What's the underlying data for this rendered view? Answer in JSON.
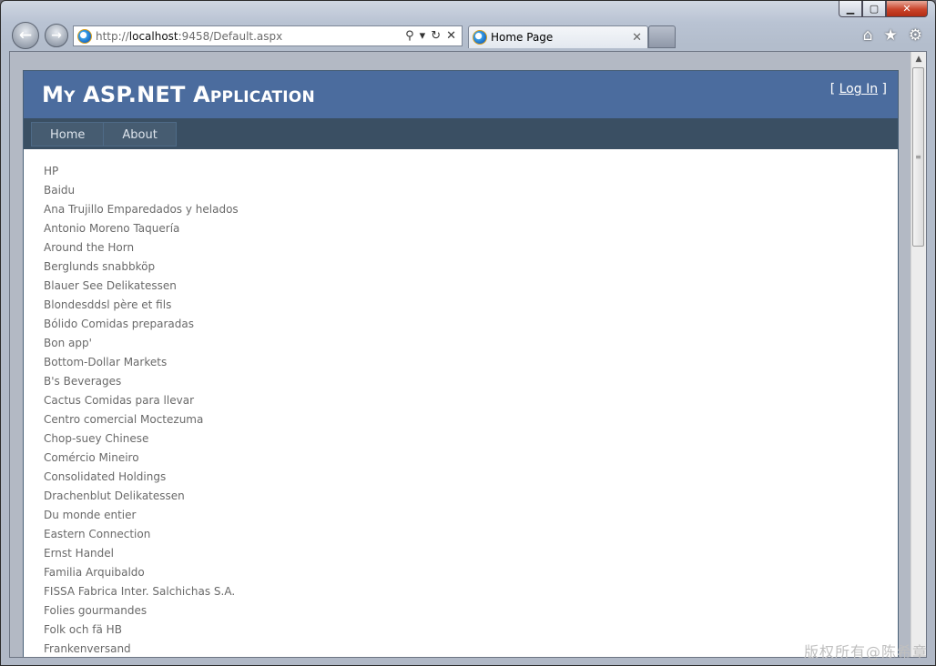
{
  "browser": {
    "address_prefix": "http://",
    "address_host": "localhost",
    "address_rest": ":9458/Default.aspx",
    "tab_title": "Home Page"
  },
  "app": {
    "title": "My ASP.NET Application",
    "login_open": "[ ",
    "login_link": "Log In",
    "login_close": " ]"
  },
  "menu": {
    "items": [
      {
        "label": "Home"
      },
      {
        "label": "About"
      }
    ]
  },
  "customers": [
    "HP",
    "Baidu",
    "Ana Trujillo Emparedados y helados",
    "Antonio Moreno Taquería",
    "Around the Horn",
    "Berglunds snabbköp",
    "Blauer See Delikatessen",
    "Blondesddsl père et fils",
    "Bólido Comidas preparadas",
    "Bon app'",
    "Bottom-Dollar Markets",
    "B's Beverages",
    "Cactus Comidas para llevar",
    "Centro comercial Moctezuma",
    "Chop-suey Chinese",
    "Comércio Mineiro",
    "Consolidated Holdings",
    "Drachenblut Delikatessen",
    "Du monde entier",
    "Eastern Connection",
    "Ernst Handel",
    "Familia Arquibaldo",
    "FISSA Fabrica Inter. Salchichas S.A.",
    "Folies gourmandes",
    "Folk och fä HB",
    "Frankenversand"
  ],
  "watermark": "版权所有@陈希章"
}
